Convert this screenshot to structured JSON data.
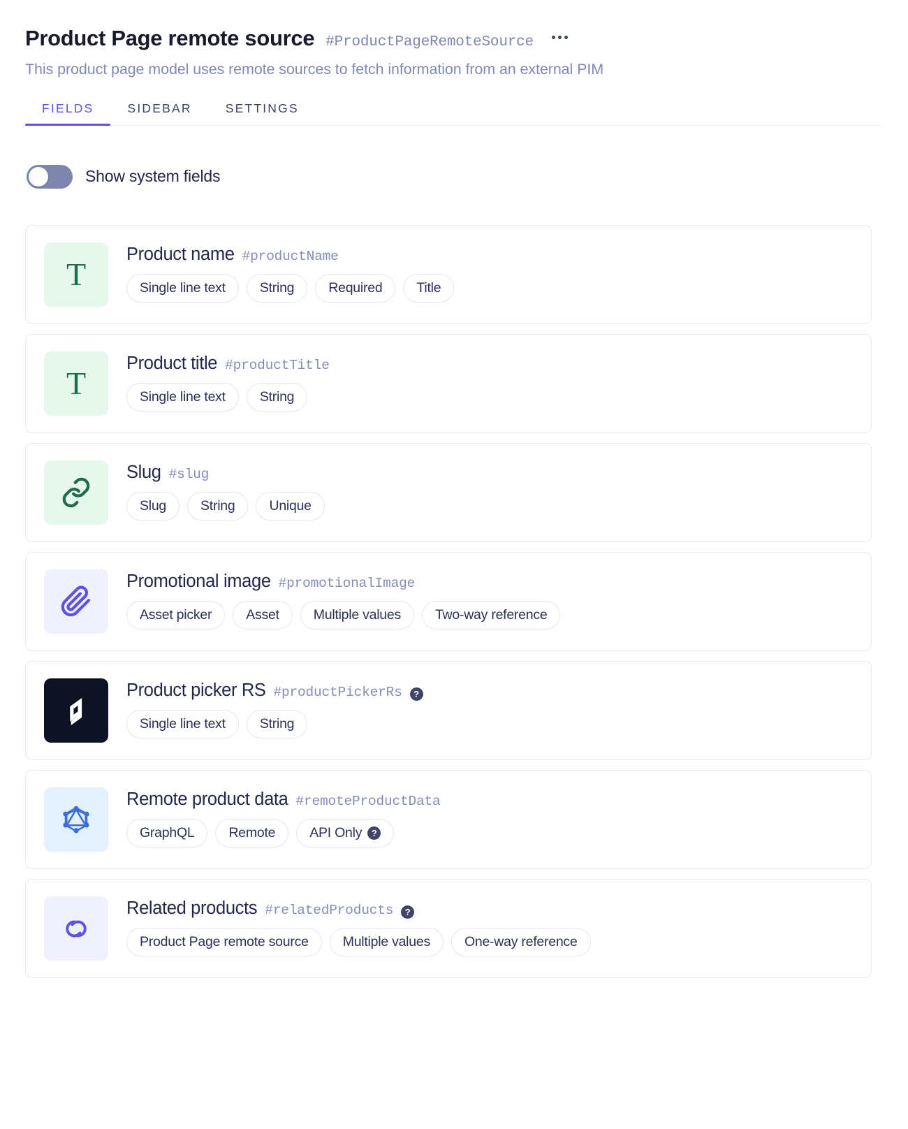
{
  "header": {
    "title": "Product Page remote source",
    "api_id": "#ProductPageRemoteSource",
    "description": "This product page model uses remote sources to fetch information from an external PIM",
    "more_menu": "more-options"
  },
  "tabs": [
    {
      "label": "FIELDS",
      "active": true
    },
    {
      "label": "SIDEBAR",
      "active": false
    },
    {
      "label": "SETTINGS",
      "active": false
    }
  ],
  "toggle": {
    "label": "Show system fields",
    "enabled": false
  },
  "colors": {
    "accent": "#5b51e8",
    "title": "#18192b",
    "muted": "#8289b5",
    "chip_border": "#e4e5f2",
    "card_border": "#e9eaf5",
    "icon_green_bg": "#e6f7ec",
    "icon_violet_bg": "#f1f0fe",
    "icon_blue_bg": "#e4f0fd",
    "icon_dark_bg": "#0e1324",
    "green_glyph": "#1d6b4f",
    "violet_glyph": "#5b51e8",
    "blue_glyph": "#3a6fd8"
  },
  "help_glyph": "?",
  "fields": [
    {
      "name": "Product name",
      "api_id": "#productName",
      "icon": "text-single-line-icon",
      "has_help": false,
      "chips": [
        {
          "label": "Single line text",
          "help": false
        },
        {
          "label": "String",
          "help": false
        },
        {
          "label": "Required",
          "help": false
        },
        {
          "label": "Title",
          "help": false
        }
      ]
    },
    {
      "name": "Product title",
      "api_id": "#productTitle",
      "icon": "text-single-line-icon",
      "has_help": false,
      "chips": [
        {
          "label": "Single line text",
          "help": false
        },
        {
          "label": "String",
          "help": false
        }
      ]
    },
    {
      "name": "Slug",
      "api_id": "#slug",
      "icon": "link-icon",
      "has_help": false,
      "chips": [
        {
          "label": "Slug",
          "help": false
        },
        {
          "label": "String",
          "help": false
        },
        {
          "label": "Unique",
          "help": false
        }
      ]
    },
    {
      "name": "Promotional image",
      "api_id": "#promotionalImage",
      "icon": "paperclip-icon",
      "has_help": false,
      "chips": [
        {
          "label": "Asset picker",
          "help": false
        },
        {
          "label": "Asset",
          "help": false
        },
        {
          "label": "Multiple values",
          "help": false
        },
        {
          "label": "Two-way reference",
          "help": false
        }
      ]
    },
    {
      "name": "Product picker RS",
      "api_id": "#productPickerRs",
      "icon": "app-logo-icon",
      "has_help": true,
      "chips": [
        {
          "label": "Single line text",
          "help": false
        },
        {
          "label": "String",
          "help": false
        }
      ]
    },
    {
      "name": "Remote product data",
      "api_id": "#remoteProductData",
      "icon": "graphql-icon",
      "has_help": false,
      "chips": [
        {
          "label": "GraphQL",
          "help": false
        },
        {
          "label": "Remote",
          "help": false
        },
        {
          "label": "API Only",
          "help": true
        }
      ]
    },
    {
      "name": "Related products",
      "api_id": "#relatedProducts",
      "icon": "reference-rings-icon",
      "has_help": true,
      "chips": [
        {
          "label": "Product Page remote source",
          "help": false
        },
        {
          "label": "Multiple values",
          "help": false
        },
        {
          "label": "One-way reference",
          "help": false
        }
      ]
    }
  ]
}
